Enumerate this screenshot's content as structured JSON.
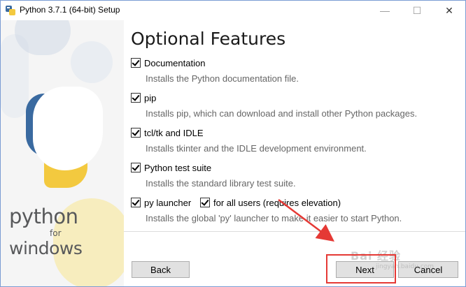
{
  "window": {
    "title": "Python 3.7.1 (64-bit) Setup",
    "controls": {
      "minimize": "—",
      "maximize": "☐",
      "close": "✕"
    }
  },
  "branding": {
    "line1": "python",
    "line2": "for",
    "line3": "windows"
  },
  "page": {
    "heading": "Optional Features"
  },
  "options": [
    {
      "label": "Documentation",
      "checked": true,
      "description": "Installs the Python documentation file."
    },
    {
      "label": "pip",
      "checked": true,
      "description": "Installs pip, which can download and install other Python packages."
    },
    {
      "label": "tcl/tk and IDLE",
      "checked": true,
      "description": "Installs tkinter and the IDLE development environment."
    },
    {
      "label": "Python test suite",
      "checked": true,
      "description": "Installs the standard library test suite."
    },
    {
      "label": "py launcher",
      "checked": true,
      "description": "Installs the global 'py' launcher to make it easier to start Python."
    }
  ],
  "extra_option": {
    "label": "for all users (requires elevation)",
    "checked": true
  },
  "buttons": {
    "back": "Back",
    "next": "Next",
    "cancel": "Cancel"
  },
  "watermark": {
    "text": "Bai 经验",
    "sub": "jingyan.baidu.com"
  },
  "colors": {
    "highlight": "#e53935",
    "python_blue": "#3a6aa0",
    "python_yellow": "#f3c93f"
  }
}
